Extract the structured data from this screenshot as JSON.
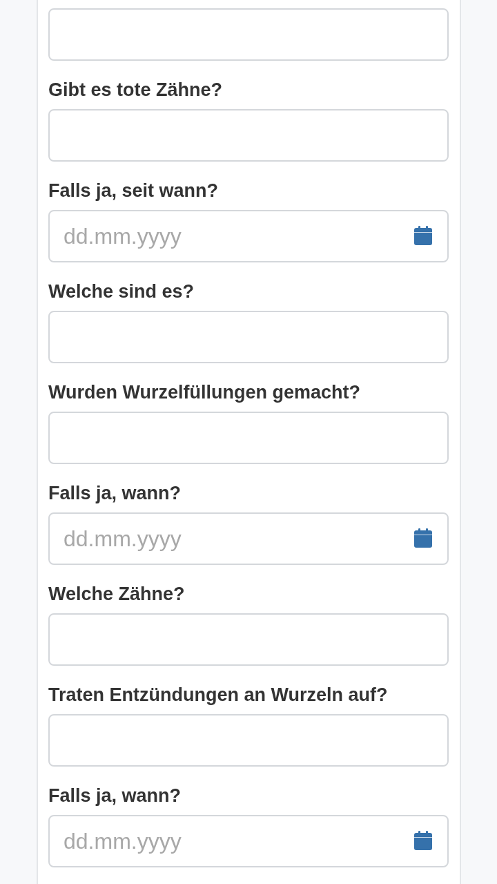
{
  "form": {
    "fields": [
      {
        "kind": "text"
      },
      {
        "kind": "text",
        "label": "Gibt es tote Zähne?"
      },
      {
        "kind": "date",
        "label": "Falls ja, seit wann?",
        "placeholder": "dd.mm.yyyy"
      },
      {
        "kind": "text",
        "label": "Welche sind es?"
      },
      {
        "kind": "text",
        "label": "Wurden Wurzelfüllungen gemacht?"
      },
      {
        "kind": "date",
        "label": "Falls ja, wann?",
        "placeholder": "dd.mm.yyyy"
      },
      {
        "kind": "text",
        "label": "Welche Zähne?"
      },
      {
        "kind": "text",
        "label": "Traten Entzündungen an Wurzeln auf?"
      },
      {
        "kind": "date",
        "label": "Falls ja, wann?",
        "placeholder": "dd.mm.yyyy"
      }
    ]
  }
}
